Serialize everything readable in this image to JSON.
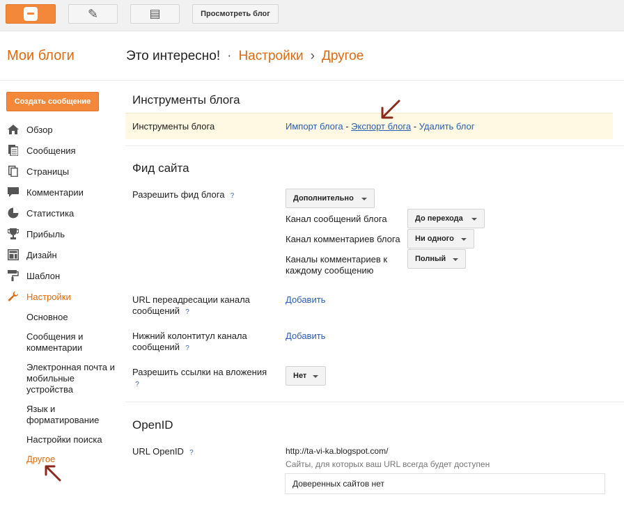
{
  "topbar": {
    "blogger_icon": "blogger-logo",
    "edit_icon": "pencil-icon",
    "pages_icon": "pages-icon",
    "view_blog_label": "Просмотреть блог"
  },
  "header": {
    "my_blogs": "Мои блоги",
    "blog_title": "Это интересно!",
    "sep1": "·",
    "crumb_settings": "Настройки",
    "sep2": "›",
    "crumb_other": "Другое"
  },
  "sidebar": {
    "create_post": "Создать сообщение",
    "items": [
      {
        "label": "Обзор",
        "icon": "home-icon"
      },
      {
        "label": "Сообщения",
        "icon": "posts-icon"
      },
      {
        "label": "Страницы",
        "icon": "pages-icon"
      },
      {
        "label": "Комментарии",
        "icon": "comment-icon"
      },
      {
        "label": "Статистика",
        "icon": "pie-chart-icon"
      },
      {
        "label": "Прибыль",
        "icon": "trophy-icon"
      },
      {
        "label": "Дизайн",
        "icon": "layout-icon"
      },
      {
        "label": "Шаблон",
        "icon": "paint-roller-icon"
      },
      {
        "label": "Настройки",
        "icon": "wrench-icon"
      }
    ],
    "sub_items": [
      "Основное",
      "Сообщения и комментарии",
      "Электронная почта и мобильные устройства",
      "Язык и форматирование",
      "Настройки поиска",
      "Другое"
    ]
  },
  "tools": {
    "section_title": "Инструменты блога",
    "row_label": "Инструменты блога",
    "import": "Импорт блога",
    "dash": " - ",
    "export": "Экспорт блога",
    "delete": "Удалить блог"
  },
  "feed": {
    "section_title": "Фид сайта",
    "allow_feed_label": "Разрешить фид блога",
    "allow_feed_value": "Дополнительно",
    "post_feed_label": "Канал сообщений блога",
    "post_feed_value": "До перехода",
    "comment_feed_label": "Канал комментариев блога",
    "comment_feed_value": "Ни одного",
    "per_post_label": "Каналы комментариев к каждому сообщению",
    "per_post_value": "Полный",
    "redirect_label": "URL переадресации канала сообщений",
    "redirect_action": "Добавить",
    "footer_label": "Нижний колонтитул канала сообщений",
    "footer_action": "Добавить",
    "enclosures_label": "Разрешить ссылки на вложения",
    "enclosures_value": "Нет",
    "help": "?"
  },
  "openid": {
    "section_title": "OpenID",
    "url_label": "URL OpenID",
    "url_value": "http://ta-vi-ka.blogspot.com/",
    "note": "Сайты, для которых ваш URL всегда будет доступен",
    "trusted": "Доверенных сайтов нет"
  },
  "colors": {
    "accent": "#dd6a11",
    "button_orange": "#f4883a",
    "link": "#2a5db0",
    "annotation_arrow": "#8b2a1c"
  }
}
